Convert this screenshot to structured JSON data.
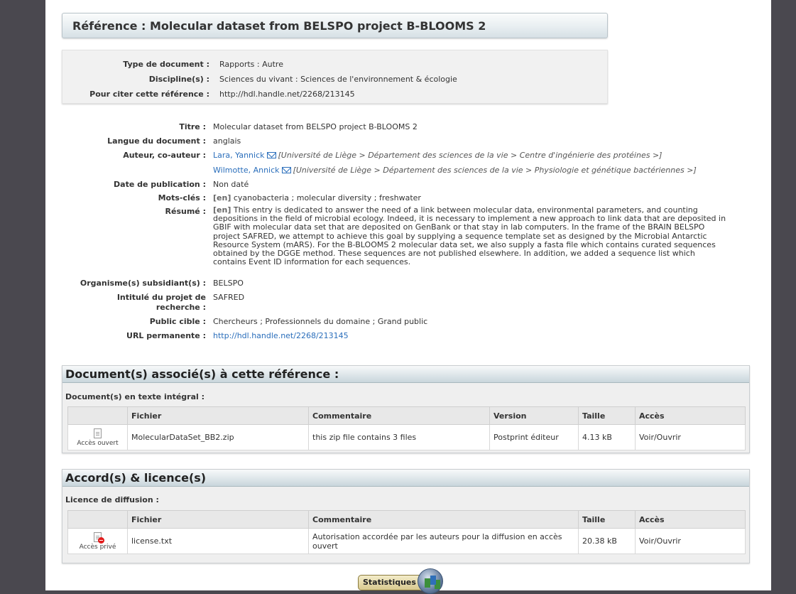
{
  "reference_title": "Référence : Molecular dataset from BELSPO project B-BLOOMS 2",
  "meta": {
    "doc_type_label": "Type de document :",
    "doc_type_value": "Rapports : Autre",
    "discipline_label": "Discipline(s) :",
    "discipline_value": "Sciences du vivant : Sciences de l'environnement & écologie",
    "cite_label": "Pour citer cette référence :",
    "cite_value": "http://hdl.handle.net/2268/213145"
  },
  "details": {
    "title_label": "Titre :",
    "title_value": "Molecular dataset from BELSPO project B-BLOOMS 2",
    "lang_label": "Langue du document :",
    "lang_value": "anglais",
    "authors_label": "Auteur, co-auteur :",
    "authors": [
      {
        "name": "Lara, Yannick",
        "affiliation": "[Université de Liège > Département des sciences de la vie > Centre d'ingénierie des protéines >]"
      },
      {
        "name": "Wilmotte, Annick",
        "affiliation": "[Université de Liège > Département des sciences de la vie > Physiologie et génétique bactériennes >]"
      }
    ],
    "date_label": "Date de publication :",
    "date_value": "Non daté",
    "keywords_label": "Mots-clés :",
    "keywords_lang": "[en]",
    "keywords_value": "cyanobacteria ; molecular diversity ; freshwater",
    "abstract_label": "Résumé :",
    "abstract_lang": "[en]",
    "abstract_lines": [
      "This entry is dedicated to answer the need of a link between molecular data, environmental parameters, and counting",
      "depositions in the field of microbial ecology. Indeed, it is necessary to implement a new approach to link data that are deposited in",
      "GBIF with molecular data set that are deposited on GenBank or that stay in lab computers. In the frame of the BRAIN BELSPO",
      "project SAFRED, we attempt to achieve this goal by supplying a sequence template set as designed by the Microbial Antarctic",
      "Resource System (mARS). For the B-BLOOMS 2 molecular data set, we also supply a fasta file which contains curated sequences",
      "obtained by the DGGE method. These sequences are not published elsewhere. In addition, we added a sequence list which",
      "contains Event ID information for each sequences."
    ],
    "org_label": "Organisme(s) subsidiant(s) :",
    "org_value": "BELSPO",
    "project_label_1": "Intitulé du projet de",
    "project_label_2": "recherche :",
    "project_value": "SAFRED",
    "audience_label": "Public cible :",
    "audience_value": "Chercheurs ; Professionnels du domaine ; Grand public",
    "url_label": "URL permanente :",
    "url_value": "http://hdl.handle.net/2268/213145"
  },
  "documents": {
    "heading": "Document(s) associé(s) à cette référence :",
    "subheading": "Document(s) en texte intégral :",
    "columns": [
      "",
      "Fichier",
      "Commentaire",
      "Version",
      "Taille",
      "Accès"
    ],
    "rows": [
      {
        "access_type": "Accès ouvert",
        "file": "MolecularDataSet_BB2.zip",
        "comment": "this zip file contains 3 files",
        "version": "Postprint éditeur",
        "size": "4.13 kB",
        "access": "Voir/Ouvrir"
      }
    ]
  },
  "licences": {
    "heading": "Accord(s) & licence(s)",
    "subheading": "Licence de diffusion :",
    "columns": [
      "",
      "Fichier",
      "Commentaire",
      "Taille",
      "Accès"
    ],
    "rows": [
      {
        "access_type": "Accès privé",
        "file": "license.txt",
        "comment_1": "Autorisation accordée par les auteurs pour la diffusion en accès",
        "comment_2": "ouvert",
        "size": "20.38 kB",
        "access": "Voir/Ouvrir"
      }
    ]
  },
  "stats_button": "Statistiques"
}
